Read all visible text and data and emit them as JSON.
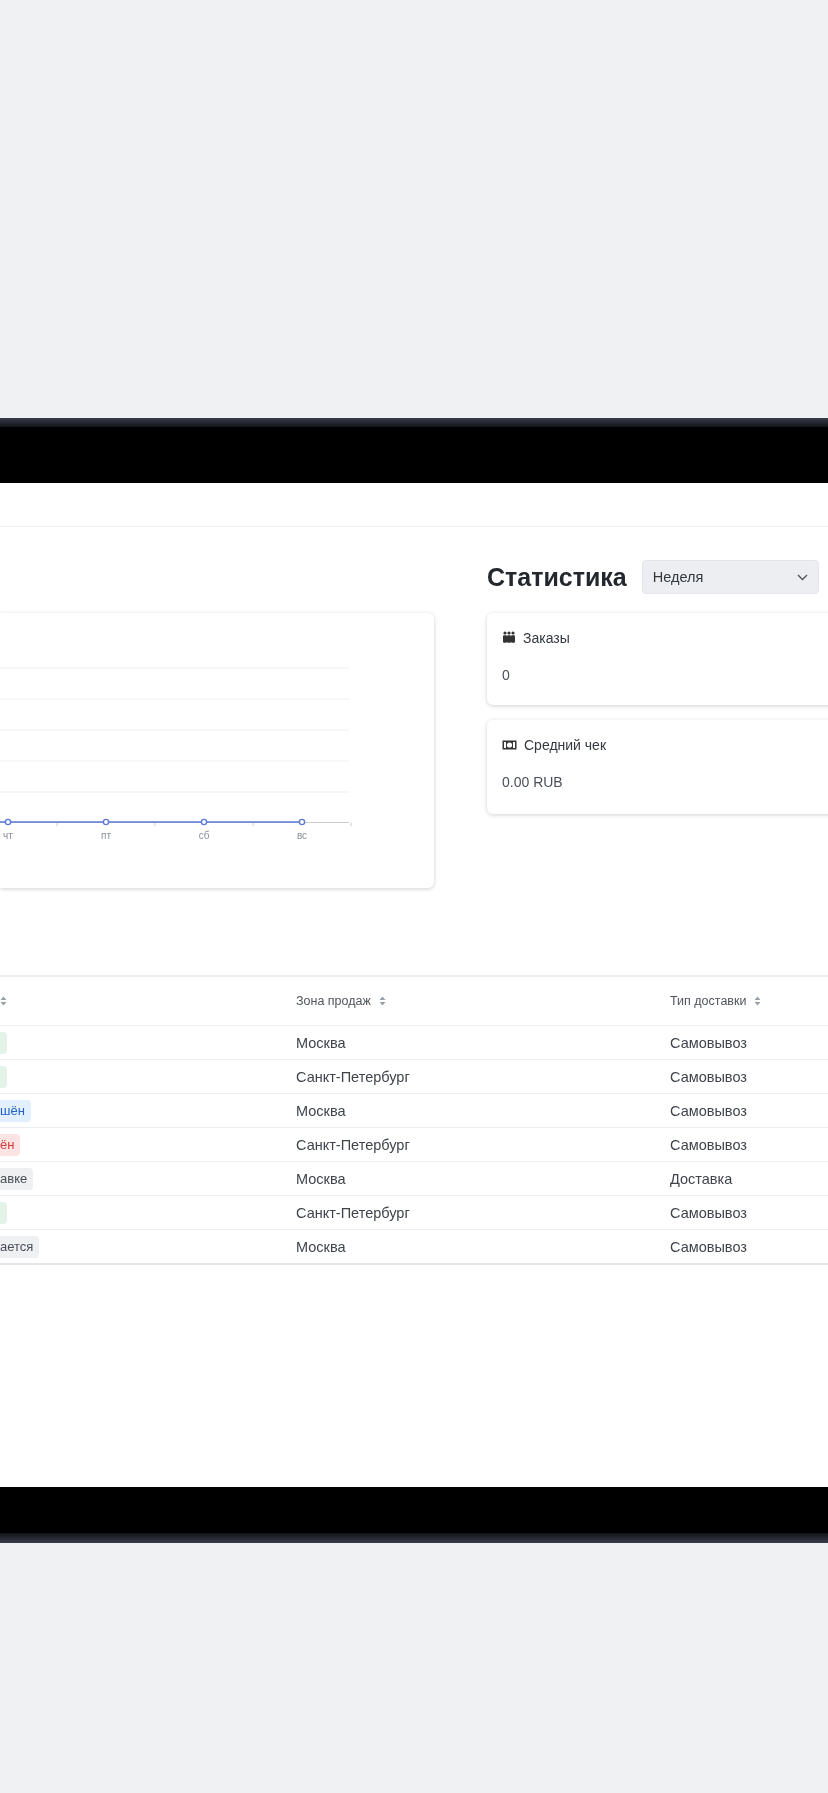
{
  "statistics": {
    "title": "Статистика",
    "period_select": {
      "value": "Неделя"
    }
  },
  "chart": {
    "x_labels": [
      "чт",
      "пт",
      "сб",
      "вс"
    ]
  },
  "stat_cards": [
    {
      "kind": "orders",
      "label": "Заказы",
      "value": "0"
    },
    {
      "kind": "average",
      "label": "Средний чек",
      "value": "0.00 RUB"
    }
  ],
  "table": {
    "columns": [
      {
        "sortable": true
      },
      {
        "label": "Зона продаж",
        "sortable": true
      },
      {
        "label": "Тип доставки",
        "sortable": true
      }
    ],
    "rows": [
      {
        "status": {
          "kind": "success"
        },
        "zone": "Москва",
        "delivery": "Самовывоз"
      },
      {
        "status": {
          "kind": "success"
        },
        "zone": "Санкт-Петербург",
        "delivery": "Самовывоз"
      },
      {
        "status": {
          "kind": "info",
          "text": "шён"
        },
        "zone": "Москва",
        "delivery": "Самовывоз"
      },
      {
        "status": {
          "kind": "error",
          "text": "ён"
        },
        "zone": "Санкт-Петербург",
        "delivery": "Самовывоз"
      },
      {
        "status": {
          "kind": "neutral",
          "text": "авке"
        },
        "zone": "Москва",
        "delivery": "Доставка"
      },
      {
        "status": {
          "kind": "success"
        },
        "zone": "Санкт-Петербург",
        "delivery": "Самовывоз"
      },
      {
        "status": {
          "kind": "neutral",
          "text": "ается"
        },
        "zone": "Москва",
        "delivery": "Самовывоз"
      }
    ]
  }
}
